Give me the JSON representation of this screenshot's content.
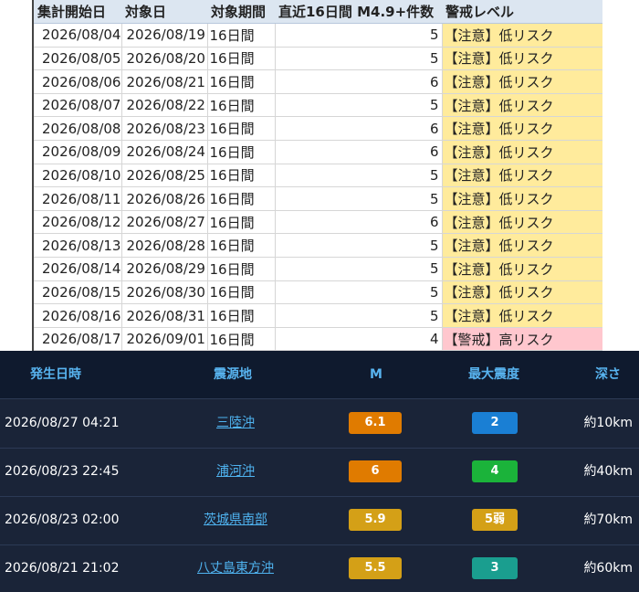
{
  "sheet": {
    "headers": [
      "集計開始日",
      "対象日",
      "対象期間",
      "直近16日間 M4.9+件数",
      "警戒レベル"
    ],
    "rows": [
      {
        "start": "2026/08/04",
        "target": "2026/08/19",
        "period": "16日間",
        "count": "5",
        "level": "【注意】低リスク",
        "level_type": "caution"
      },
      {
        "start": "2026/08/05",
        "target": "2026/08/20",
        "period": "16日間",
        "count": "5",
        "level": "【注意】低リスク",
        "level_type": "caution"
      },
      {
        "start": "2026/08/06",
        "target": "2026/08/21",
        "period": "16日間",
        "count": "6",
        "level": "【注意】低リスク",
        "level_type": "caution"
      },
      {
        "start": "2026/08/07",
        "target": "2026/08/22",
        "period": "16日間",
        "count": "5",
        "level": "【注意】低リスク",
        "level_type": "caution"
      },
      {
        "start": "2026/08/08",
        "target": "2026/08/23",
        "period": "16日間",
        "count": "6",
        "level": "【注意】低リスク",
        "level_type": "caution"
      },
      {
        "start": "2026/08/09",
        "target": "2026/08/24",
        "period": "16日間",
        "count": "6",
        "level": "【注意】低リスク",
        "level_type": "caution"
      },
      {
        "start": "2026/08/10",
        "target": "2026/08/25",
        "period": "16日間",
        "count": "5",
        "level": "【注意】低リスク",
        "level_type": "caution"
      },
      {
        "start": "2026/08/11",
        "target": "2026/08/26",
        "period": "16日間",
        "count": "5",
        "level": "【注意】低リスク",
        "level_type": "caution"
      },
      {
        "start": "2026/08/12",
        "target": "2026/08/27",
        "period": "16日間",
        "count": "6",
        "level": "【注意】低リスク",
        "level_type": "caution"
      },
      {
        "start": "2026/08/13",
        "target": "2026/08/28",
        "period": "16日間",
        "count": "5",
        "level": "【注意】低リスク",
        "level_type": "caution"
      },
      {
        "start": "2026/08/14",
        "target": "2026/08/29",
        "period": "16日間",
        "count": "5",
        "level": "【注意】低リスク",
        "level_type": "caution"
      },
      {
        "start": "2026/08/15",
        "target": "2026/08/30",
        "period": "16日間",
        "count": "5",
        "level": "【注意】低リスク",
        "level_type": "caution"
      },
      {
        "start": "2026/08/16",
        "target": "2026/08/31",
        "period": "16日間",
        "count": "5",
        "level": "【注意】低リスク",
        "level_type": "caution"
      },
      {
        "start": "2026/08/17",
        "target": "2026/09/01",
        "period": "16日間",
        "count": "4",
        "level": "【警戒】高リスク",
        "level_type": "warning"
      }
    ]
  },
  "quakes": {
    "headers": {
      "time": "発生日時",
      "epicenter": "震源地",
      "magnitude": "M",
      "intensity": "最大震度",
      "depth": "深さ"
    },
    "rows": [
      {
        "time": "2026/08/27 04:21",
        "epicenter": "三陸沖",
        "magnitude": "6.1",
        "mag_color": "#e07b00",
        "intensity": "2",
        "int_color": "#1a7fd4",
        "depth": "約10km"
      },
      {
        "time": "2026/08/23 22:45",
        "epicenter": "浦河沖",
        "magnitude": "6",
        "mag_color": "#e07b00",
        "intensity": "4",
        "int_color": "#1bb33a",
        "depth": "約40km"
      },
      {
        "time": "2026/08/23 02:00",
        "epicenter": "茨城県南部",
        "magnitude": "5.9",
        "mag_color": "#d4a017",
        "intensity": "5弱",
        "int_color": "#d4a017",
        "depth": "約70km"
      },
      {
        "time": "2026/08/21 21:02",
        "epicenter": "八丈島東方沖",
        "magnitude": "5.5",
        "mag_color": "#d4a017",
        "intensity": "3",
        "int_color": "#1a9e8f",
        "depth": "約60km"
      }
    ]
  }
}
